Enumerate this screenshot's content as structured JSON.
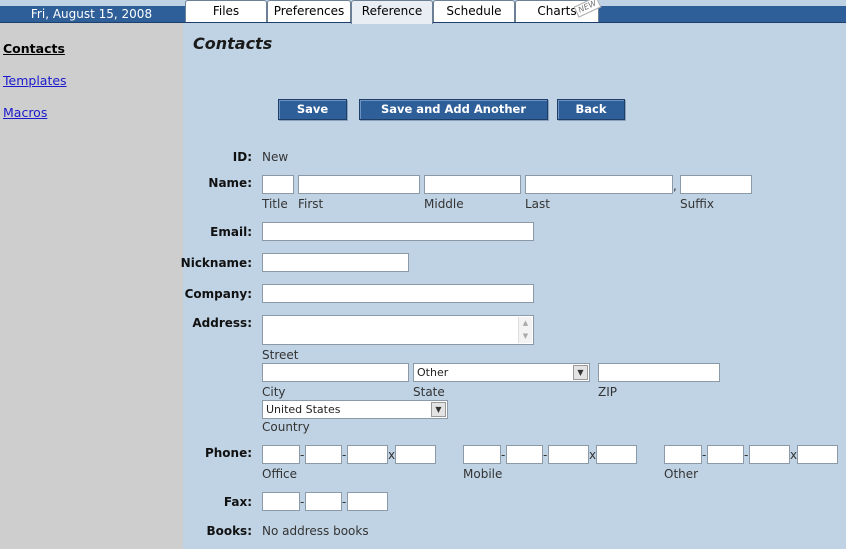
{
  "date": "Fri, August 15, 2008",
  "tabs": [
    {
      "label": "Files"
    },
    {
      "label": "Preferences"
    },
    {
      "label": "Reference"
    },
    {
      "label": "Schedule"
    },
    {
      "label": "Charts",
      "badge": "NEW"
    }
  ],
  "sidebar": {
    "items": [
      {
        "label": "Contacts"
      },
      {
        "label": "Templates"
      },
      {
        "label": "Macros"
      }
    ]
  },
  "page_title": "Contacts",
  "buttons": {
    "save": "Save",
    "save_add": "Save and Add Another",
    "back": "Back"
  },
  "form": {
    "id_label": "ID:",
    "id_value": "New",
    "name_label": "Name:",
    "name_sub": {
      "title": "Title",
      "first": "First",
      "middle": "Middle",
      "last": "Last",
      "suffix": "Suffix"
    },
    "name_comma": ",",
    "email_label": "Email:",
    "nickname_label": "Nickname:",
    "company_label": "Company:",
    "address_label": "Address:",
    "address_sub": {
      "street": "Street",
      "city": "City",
      "state": "State",
      "zip": "ZIP",
      "country": "Country"
    },
    "state_value": "Other",
    "country_value": "United States",
    "phone_label": "Phone:",
    "phone_sub": {
      "office": "Office",
      "mobile": "Mobile",
      "other": "Other"
    },
    "fax_label": "Fax:",
    "books_label": "Books:",
    "books_value": "No address books"
  }
}
